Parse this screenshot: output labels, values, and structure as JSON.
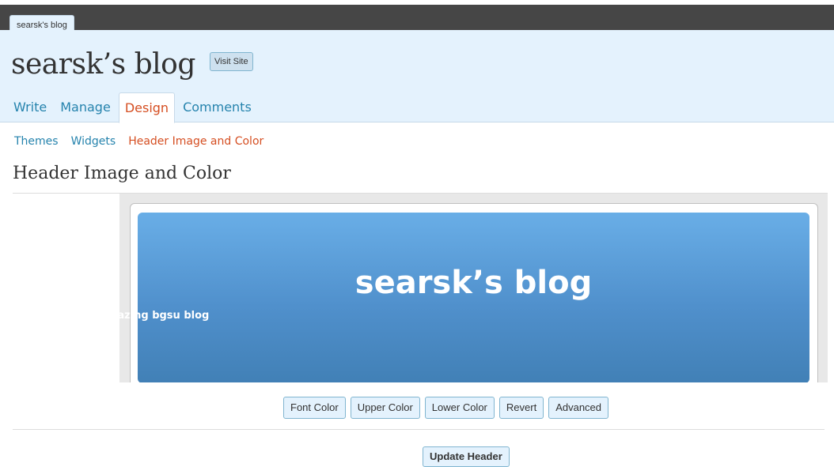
{
  "browser": {
    "tab_label": "searsk's blog"
  },
  "header": {
    "site_title": "searsk’s blog",
    "visit_site_label": "Visit Site"
  },
  "tabs": [
    {
      "label": "Write",
      "active": false
    },
    {
      "label": "Manage",
      "active": false
    },
    {
      "label": "Design",
      "active": true
    },
    {
      "label": "Comments",
      "active": false
    }
  ],
  "subnav": [
    {
      "label": "Themes",
      "current": false
    },
    {
      "label": "Widgets",
      "current": false
    },
    {
      "label": "Header Image and Color",
      "current": true
    }
  ],
  "page": {
    "heading": "Header Image and Color"
  },
  "preview": {
    "blog_name": "searsk’s blog",
    "tagline": "amazing bgsu blog"
  },
  "color_buttons": [
    {
      "label": "Font Color"
    },
    {
      "label": "Upper Color"
    },
    {
      "label": "Lower Color"
    },
    {
      "label": "Revert"
    },
    {
      "label": "Advanced"
    }
  ],
  "update_button_label": "Update Header",
  "colors": {
    "admin_header_bg": "#e4f2fd",
    "link_blue": "#2583ad",
    "active_orange": "#d54e21",
    "gradient_top": "#69aee7",
    "gradient_bottom": "#4180b6"
  }
}
